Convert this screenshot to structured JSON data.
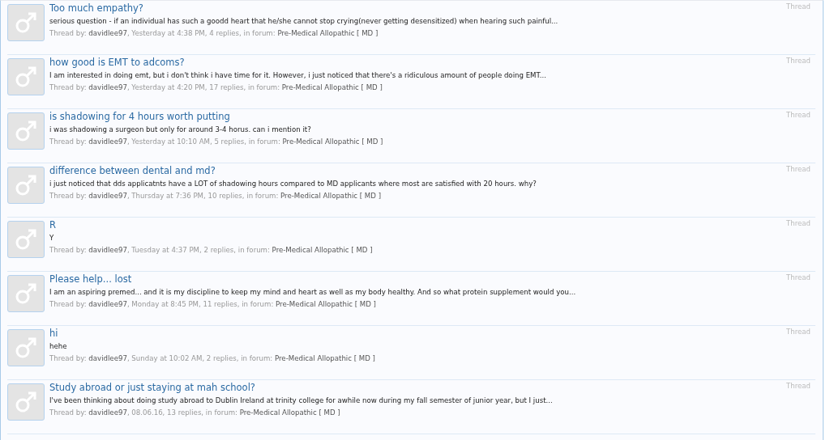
{
  "threads": [
    {
      "title": "Too much empathy?",
      "snippet": "serious question - if an individual has such a goodd heart that he/she cannot stop crying(never getting desensitized) when hearing such painful...",
      "by_label": "Thread by:",
      "author": "davidlee97",
      "details": ", Yesterday at 4:38 PM, 4 replies, in forum:",
      "forum": "Pre-Medical Allopathic [ MD ]",
      "type": "Thread"
    },
    {
      "title": "how good is EMT to adcoms?",
      "snippet": "I am interested in doing emt, but i don't think i have time for it. However, i just noticed that there's a ridiculous amount of people doing EMT...",
      "by_label": "Thread by:",
      "author": "davidlee97",
      "details": ", Yesterday at 4:20 PM, 17 replies, in forum:",
      "forum": "Pre-Medical Allopathic [ MD ]",
      "type": "Thread"
    },
    {
      "title": "is shadowing for 4 hours worth putting",
      "snippet": "i was shadowing a surgeon but only for around 3-4 horus. can i mention it?",
      "by_label": "Thread by:",
      "author": "davidlee97",
      "details": ", Yesterday at 10:10 AM, 5 replies, in forum:",
      "forum": "Pre-Medical Allopathic [ MD ]",
      "type": "Thread"
    },
    {
      "title": "difference between dental and md?",
      "snippet": "i just noticed that dds applicatnts have a LOT of shadowing hours compared to MD applicants where most are satisfied with 20 hours. why?",
      "by_label": "Thread by:",
      "author": "davidlee97",
      "details": ", Thursday at 7:36 PM, 10 replies, in forum:",
      "forum": "Pre-Medical Allopathic [ MD ]",
      "type": "Thread"
    },
    {
      "title": "R",
      "snippet": "Y",
      "by_label": "Thread by:",
      "author": "davidlee97",
      "details": ", Tuesday at 4:37 PM, 2 replies, in forum:",
      "forum": "Pre-Medical Allopathic [ MD ]",
      "type": "Thread"
    },
    {
      "title": "Please help... lost",
      "snippet": "I am an aspiring premed... and it is my discipline to keep my mind and heart as well as my body healthy. And so what protein supplement would you...",
      "by_label": "Thread by:",
      "author": "davidlee97",
      "details": ", Monday at 8:45 PM, 11 replies, in forum:",
      "forum": "Pre-Medical Allopathic [ MD ]",
      "type": "Thread"
    },
    {
      "title": "hi",
      "snippet": "hehe",
      "by_label": "Thread by:",
      "author": "davidlee97",
      "details": ", Sunday at 10:02 AM, 2 replies, in forum:",
      "forum": "Pre-Medical Allopathic [ MD ]",
      "type": "Thread"
    },
    {
      "title": "Study abroad or just staying at mah school?",
      "snippet": "I've been thinking about doing study abroad to Dublin Ireland at trinity college for awhile now during my fall semester of junior year, but I just...",
      "by_label": "Thread by:",
      "author": "davidlee97",
      "details": ", 08.06.16, 13 replies, in forum:",
      "forum": "Pre-Medical Allopathic [ MD ]",
      "type": "Thread"
    }
  ]
}
